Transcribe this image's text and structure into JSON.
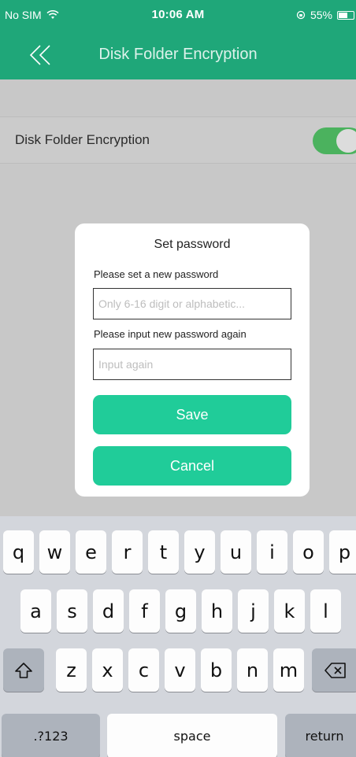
{
  "status_bar": {
    "carrier": "No SIM",
    "time": "10:06 AM",
    "battery": "55%"
  },
  "nav": {
    "title": "Disk Folder Encryption"
  },
  "setting": {
    "label": "Disk Folder Encryption",
    "enabled": true
  },
  "dialog": {
    "title": "Set password",
    "new_password_label": "Please set a new password",
    "new_password_placeholder": "Only 6-16 digit or alphabetic...",
    "new_password_value": "",
    "confirm_label": "Please input new password again",
    "confirm_placeholder": "Input again",
    "confirm_value": "",
    "save_label": "Save",
    "cancel_label": "Cancel"
  },
  "keyboard": {
    "row1": [
      "q",
      "w",
      "e",
      "r",
      "t",
      "y",
      "u",
      "i",
      "o",
      "p"
    ],
    "row2": [
      "a",
      "s",
      "d",
      "f",
      "g",
      "h",
      "j",
      "k",
      "l"
    ],
    "row3": [
      "z",
      "x",
      "c",
      "v",
      "b",
      "n",
      "m"
    ],
    "numbers_label": ".?123",
    "space_label": "space",
    "return_label": "return"
  },
  "colors": {
    "header": "#1fa779",
    "button": "#20cc99",
    "toggle_on": "#4bb25e"
  }
}
